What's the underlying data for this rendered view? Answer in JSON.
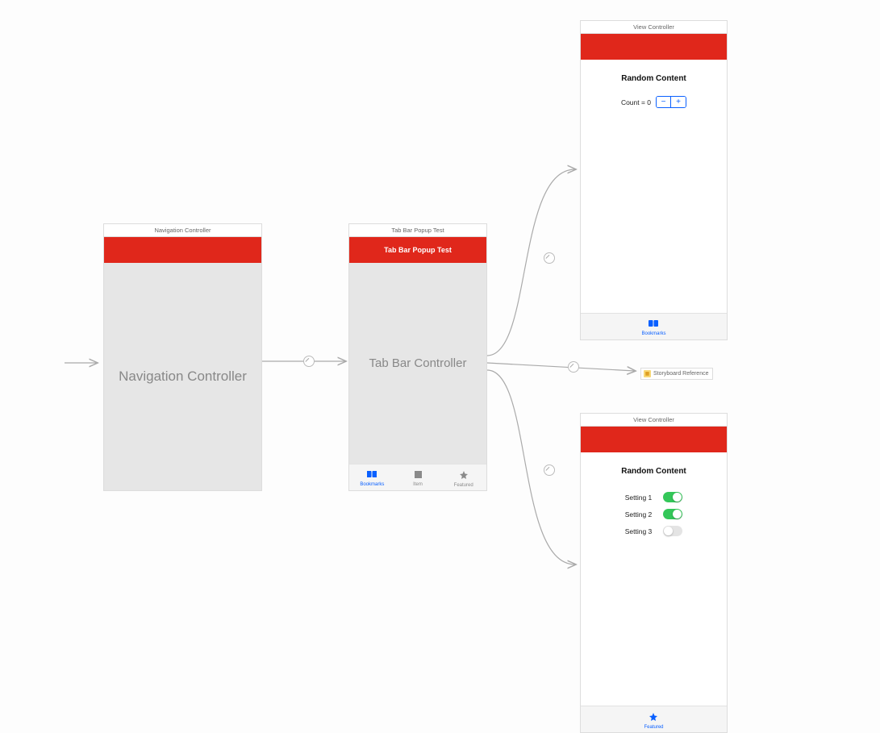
{
  "nav_scene": {
    "scene_title": "Navigation Controller",
    "placeholder": "Navigation Controller"
  },
  "tab_scene": {
    "scene_title": "Tab Bar Popup Test",
    "navbar_title": "Tab Bar Popup Test",
    "placeholder": "Tab Bar Controller",
    "tabs": [
      {
        "label": "Bookmarks",
        "icon": "bookmarks-icon",
        "active": true
      },
      {
        "label": "Item",
        "icon": "square-icon",
        "active": false
      },
      {
        "label": "Featured",
        "icon": "star-icon",
        "active": false
      }
    ]
  },
  "vc_top": {
    "scene_title": "View Controller",
    "heading": "Random Content",
    "count_label": "Count = 0",
    "tab": {
      "label": "Bookmarks",
      "icon": "bookmarks-icon"
    }
  },
  "vc_bottom": {
    "scene_title": "View Controller",
    "heading": "Random Content",
    "settings": [
      {
        "label": "Setting 1",
        "on": true
      },
      {
        "label": "Setting 2",
        "on": true
      },
      {
        "label": "Setting 3",
        "on": false
      }
    ],
    "tab": {
      "label": "Featured",
      "icon": "star-icon"
    }
  },
  "storyboard_ref_label": "Storyboard Reference"
}
